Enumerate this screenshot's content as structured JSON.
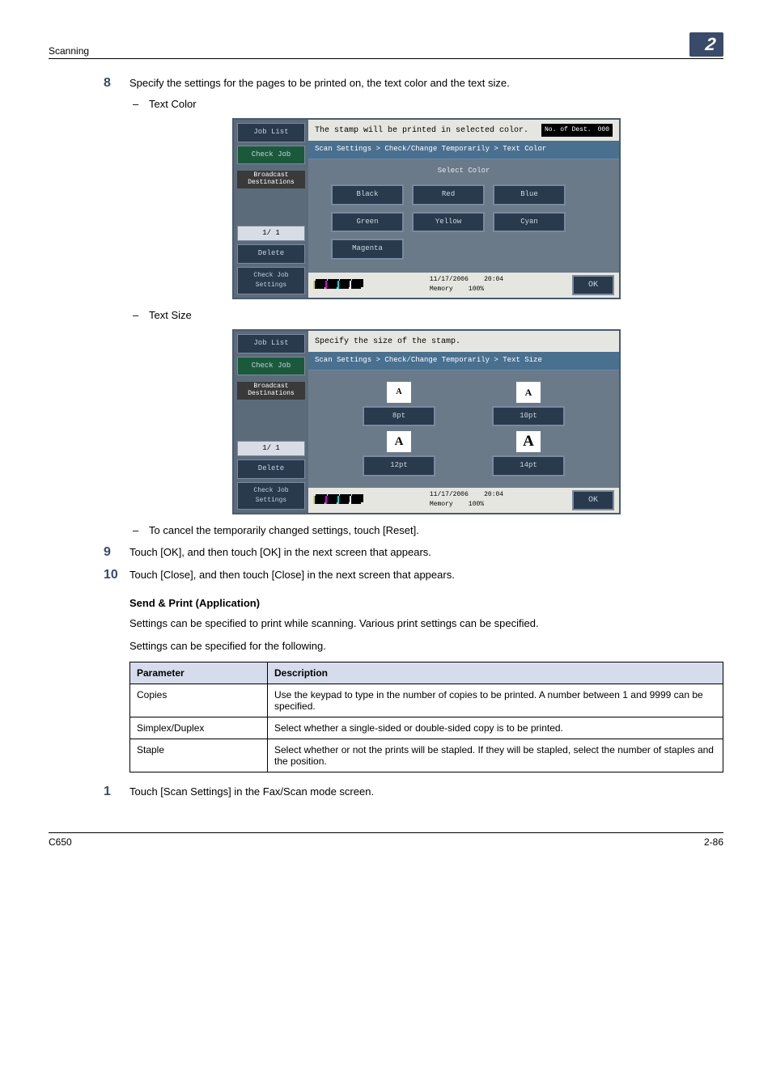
{
  "header": {
    "section": "Scanning",
    "chapter": "2"
  },
  "steps": {
    "s8": {
      "num": "8",
      "text": "Specify the settings for the pages to be printed on, the text color and the text size.",
      "sub1": "Text Color",
      "sub2": "Text Size",
      "sub3": "To cancel the temporarily changed settings, touch [Reset]."
    },
    "s9": {
      "num": "9",
      "text": "Touch [OK], and then touch [OK] in the next screen that appears."
    },
    "s10": {
      "num": "10",
      "text": "Touch [Close], and then touch [Close] in the next screen that appears."
    }
  },
  "ss_color": {
    "tabs": {
      "joblist": "Job List",
      "checkjob": "Check Job"
    },
    "bcast": "Broadcast\nDestinations",
    "page": "1/ 1",
    "delete": "Delete",
    "cjset": "Check Job\nSettings",
    "msg": "The stamp will be printed in selected color.",
    "dest_label": "No. of\nDest.",
    "dest_val": "000",
    "crumb": "Scan Settings > Check/Change Temporarily > Text Color",
    "subhead": "Select Color",
    "btns": {
      "black": "Black",
      "red": "Red",
      "blue": "Blue",
      "green": "Green",
      "yellow": "Yellow",
      "cyan": "Cyan",
      "magenta": "Magenta"
    },
    "date": "11/17/2006",
    "time": "20:04",
    "mem_label": "Memory",
    "mem_val": "100%",
    "ok": "OK"
  },
  "ss_size": {
    "msg": "Specify the size of the stamp.",
    "crumb": "Scan Settings > Check/Change Temporarily > Text Size",
    "sizes": {
      "s8": "8pt",
      "s10": "10pt",
      "s12": "12pt",
      "s14": "14pt"
    },
    "date": "11/17/2006",
    "time": "20:04",
    "mem_label": "Memory",
    "mem_val": "100%",
    "ok": "OK"
  },
  "section": {
    "title": "Send & Print (Application)",
    "p1": "Settings can be specified to print while scanning. Various print settings can be specified.",
    "p2": "Settings can be specified for the following."
  },
  "table": {
    "h1": "Parameter",
    "h2": "Description",
    "rows": [
      {
        "p": "Copies",
        "d": "Use the keypad to type in the number of copies to be printed. A number between 1 and 9999 can be specified."
      },
      {
        "p": "Simplex/Duplex",
        "d": "Select whether a single-sided or double-sided copy is to be printed."
      },
      {
        "p": "Staple",
        "d": "Select whether or not the prints will be stapled. If they will be stapled, select the number of staples and the position."
      }
    ]
  },
  "step1": {
    "num": "1",
    "text": "Touch [Scan Settings] in the Fax/Scan mode screen."
  },
  "footer": {
    "left": "C650",
    "right": "2-86"
  }
}
